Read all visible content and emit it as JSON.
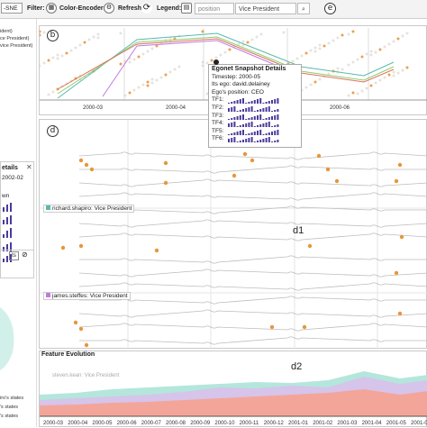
{
  "toolbar": {
    "layout_select": "-SNE",
    "filter_label": "Filter:",
    "color_encoder_label": "Color-Encoder:",
    "refresh_label": "Refresh:",
    "legend_label": "Legend:",
    "search_category": "position",
    "search_value": "Vice President",
    "search_icon": "magnifier-icon",
    "marker_e": "e"
  },
  "left_panel": {
    "legend_lines": [
      "ident)",
      "ce President)",
      "vice President)"
    ],
    "details_title": "etails",
    "details_date": "2002-02",
    "details_own": "wn",
    "toggle_text": "ts",
    "states_lines": [
      "iro's states",
      "'s states",
      "'s states"
    ]
  },
  "overview": {
    "marker": "b",
    "x_ticks": [
      "2000-03",
      "2000-04",
      "2000-06"
    ]
  },
  "tooltip": {
    "title": "Egonet Snapshot Details",
    "timestep": "Timestep: 2000-05",
    "ego": "Its ego: david.delainey",
    "position": "Ego's position: CEO",
    "tf_labels": [
      "TF1:",
      "TF2:",
      "TF3:",
      "TF4:",
      "TF5:",
      "TF6:"
    ]
  },
  "storyline": {
    "marker": "d",
    "sub_marker": "d1",
    "ego_labels": [
      "richard.shapiro: Vice President",
      "james.steffes: Vice President"
    ]
  },
  "feature_evolution": {
    "title": "Feature Evolution",
    "sub_marker": "d2",
    "faded_label": "steven.kean: Vice President",
    "x_ticks": [
      "2000-03",
      "2000-04",
      "2000-05",
      "2000-06",
      "2000-07",
      "2000-08",
      "2000-09",
      "2000-10",
      "2000-11",
      "2000-12",
      "2001-01",
      "2001-02",
      "2001-03",
      "2001-04",
      "2001-05",
      "2001-06"
    ]
  },
  "colors": {
    "node_orange": "#e8963a",
    "line_red": "#e07060",
    "line_teal": "#5bb8b0",
    "line_green": "#8ccf6a",
    "line_purple": "#c07be0",
    "bar_purple": "#4b3a9c",
    "area_red": "#f4a59a",
    "area_purple": "#d6c4ea",
    "area_teal": "#b4e6dc"
  }
}
